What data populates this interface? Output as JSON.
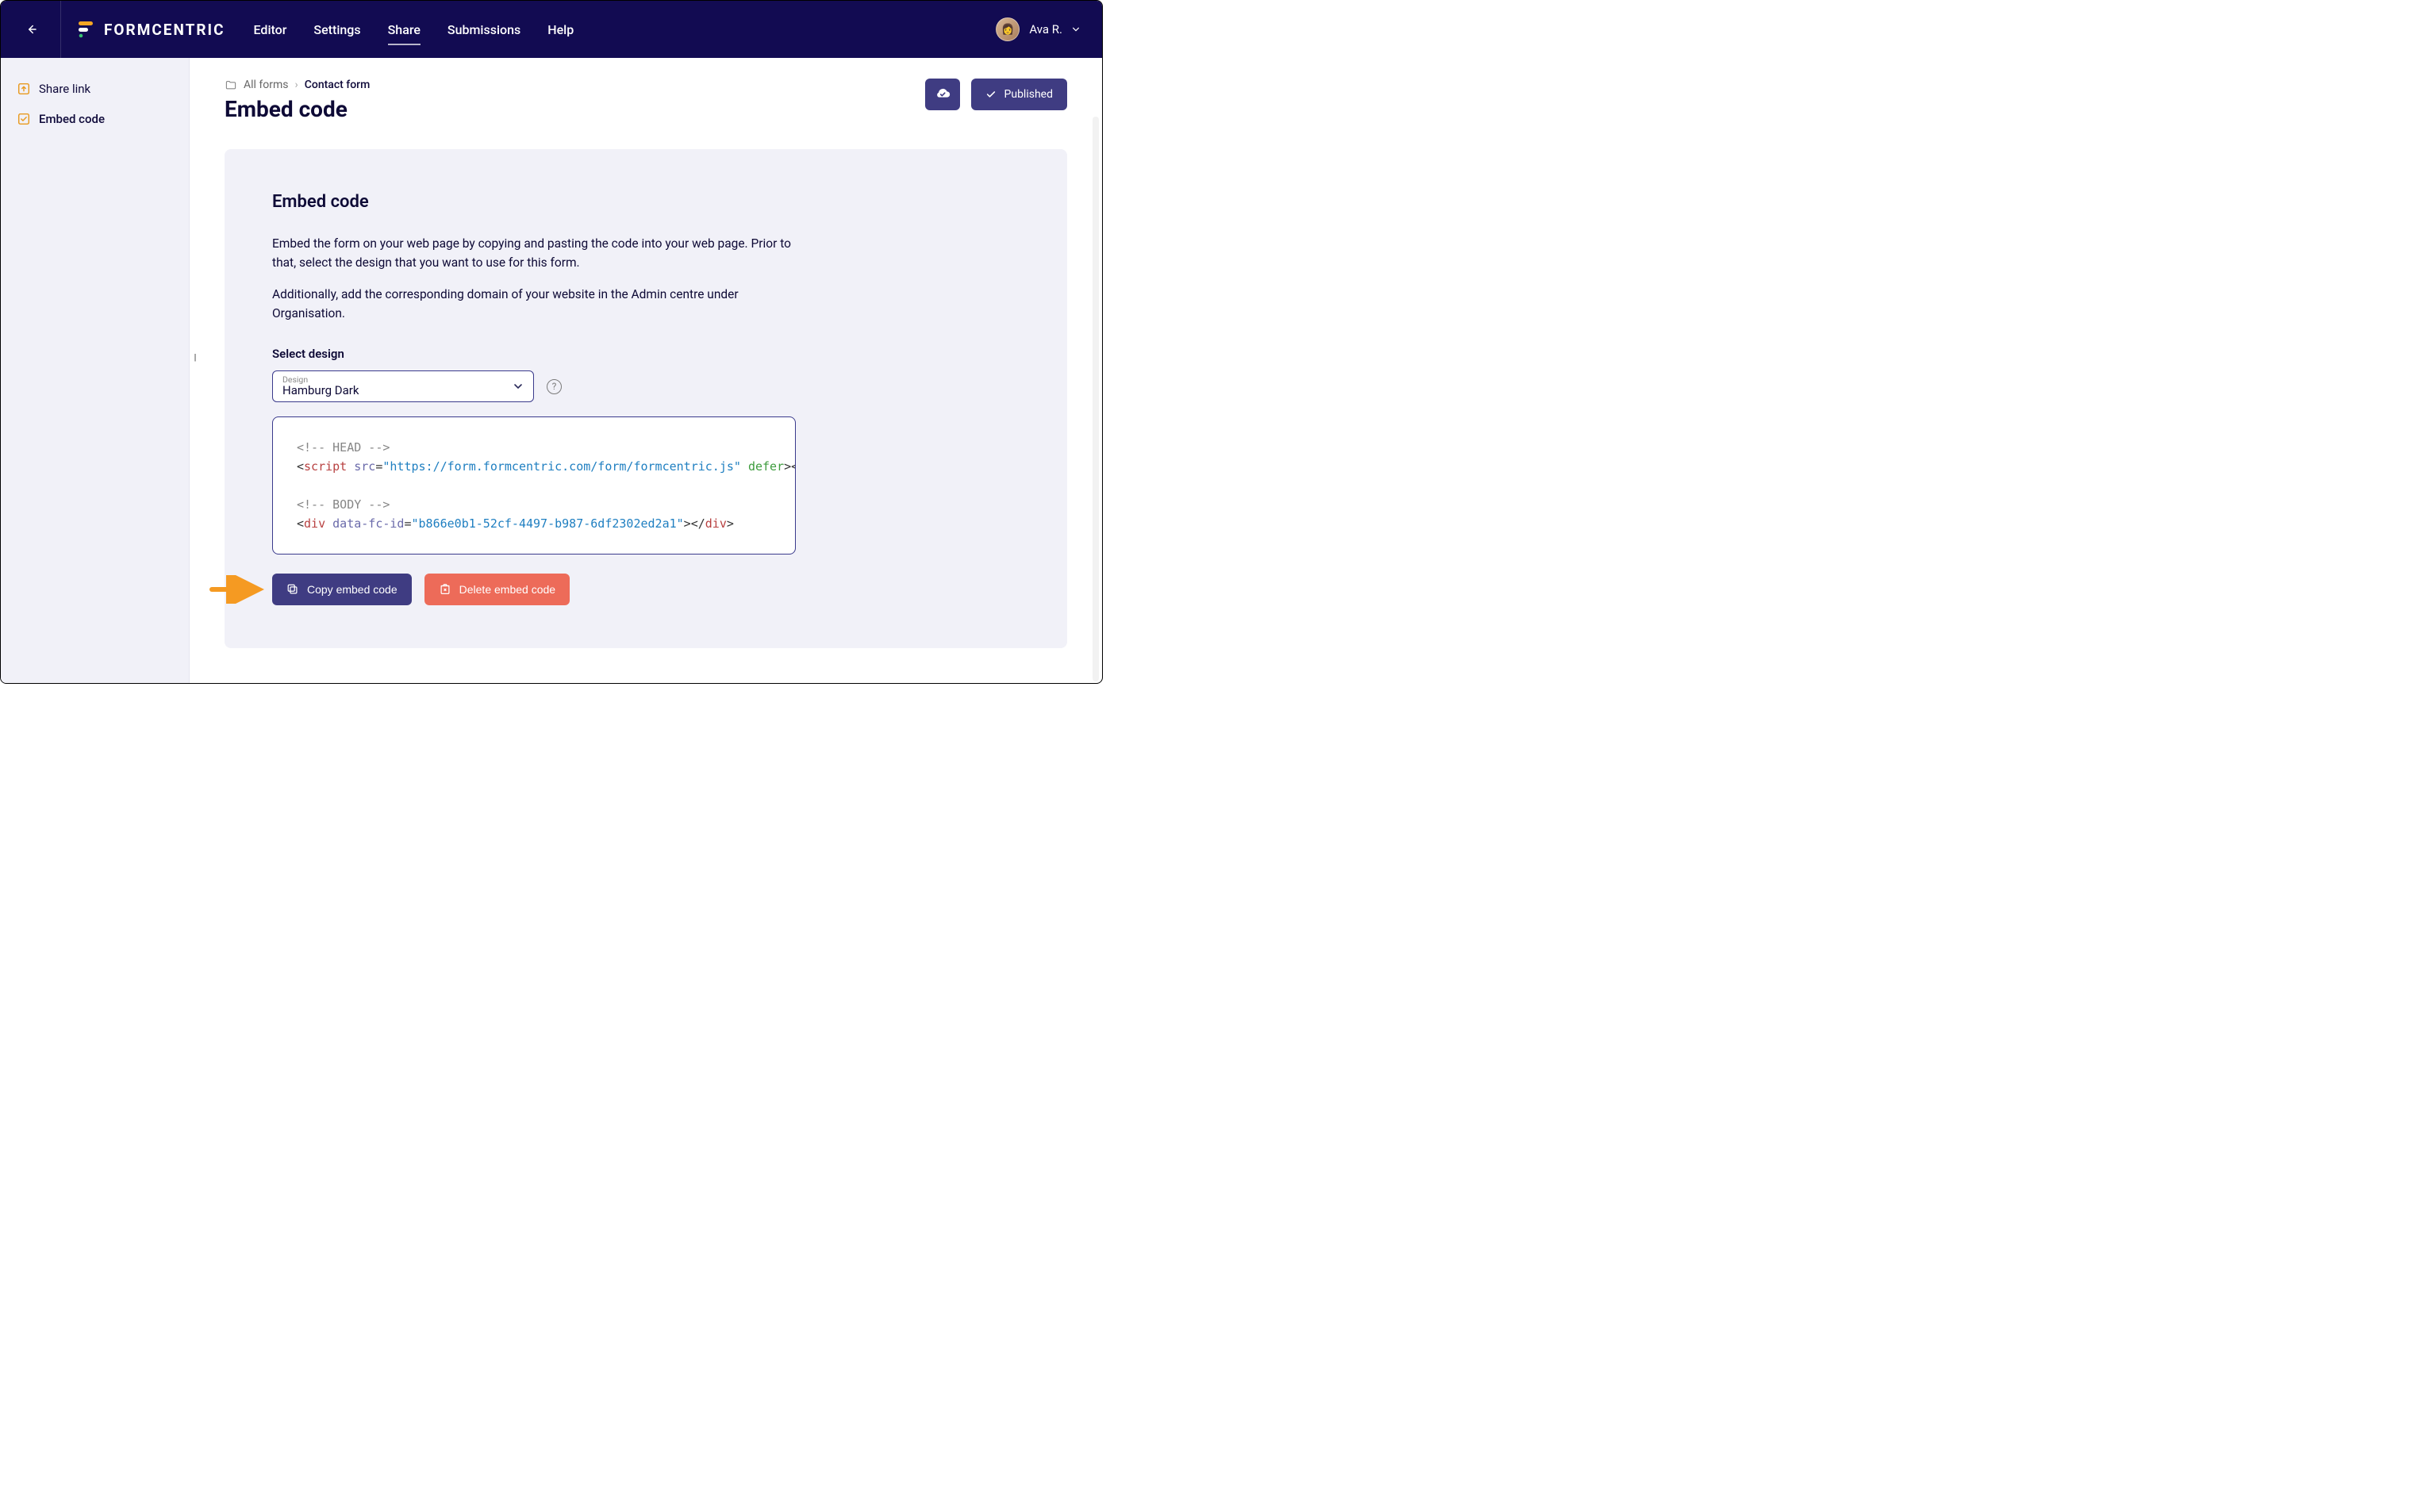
{
  "brand": {
    "name": "FORMCENTRIC"
  },
  "nav": {
    "items": [
      {
        "label": "Editor"
      },
      {
        "label": "Settings"
      },
      {
        "label": "Share"
      },
      {
        "label": "Submissions"
      },
      {
        "label": "Help"
      }
    ],
    "active_index": 2
  },
  "user": {
    "display_name": "Ava R."
  },
  "sidebar": {
    "items": [
      {
        "label": "Share link",
        "icon": "share-up"
      },
      {
        "label": "Embed code",
        "icon": "embed-check"
      }
    ],
    "active_index": 1
  },
  "breadcrumb": {
    "root": "All forms",
    "current": "Contact form"
  },
  "page": {
    "title": "Embed code"
  },
  "actions": {
    "publish_label": "Published"
  },
  "card": {
    "title": "Embed code",
    "paragraph1": "Embed the form on your web page by copying and pasting the code into your web page. Prior to that, select the design that you want to use for this form.",
    "paragraph2": "Additionally, add the corresponding domain of your website in the Admin centre under Organisation.",
    "select_label": "Select design",
    "design_field_label": "Design",
    "design_value": "Hamburg Dark",
    "code": {
      "head_comment": "<!-- HEAD -->",
      "script_src": "https://form.formcentric.com/form/formcentric.js",
      "body_comment": "<!-- BODY -->",
      "fc_id": "b866e0b1-52cf-4497-b987-6df2302ed2a1"
    }
  },
  "buttons": {
    "copy_label": "Copy embed code",
    "delete_label": "Delete embed code"
  }
}
